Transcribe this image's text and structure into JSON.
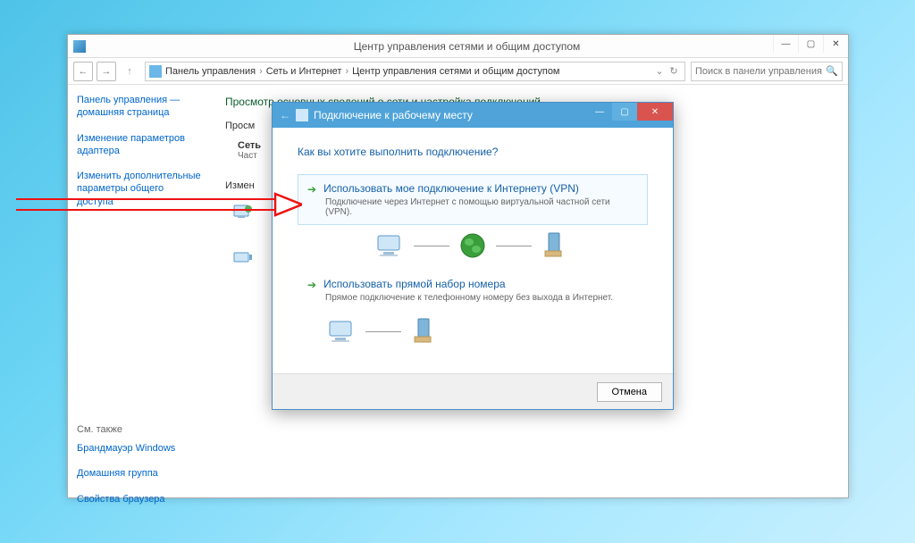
{
  "main_window": {
    "title": "Центр управления сетями и общим доступом",
    "breadcrumb": {
      "items": [
        "Панель управления",
        "Сеть и Интернет",
        "Центр управления сетями и общим доступом"
      ]
    },
    "search": {
      "placeholder": "Поиск в панели управления"
    }
  },
  "sidebar": {
    "links": [
      "Панель управления — домашняя страница",
      "Изменение параметров адаптера",
      "Изменить дополнительные параметры общего доступа"
    ],
    "footer_label": "См. также",
    "footer_links": [
      "Брандмауэр Windows",
      "Домашняя группа",
      "Свойства браузера"
    ]
  },
  "content": {
    "heading": "Просмотр основных сведений о сети и настройка подключений",
    "labels": {
      "view": "Просм",
      "network": "Сеть",
      "network_sub": "Част",
      "change": "Измен"
    }
  },
  "wizard": {
    "title": "Подключение к рабочему месту",
    "question": "Как вы хотите выполнить подключение?",
    "options": [
      {
        "title": "Использовать мое подключение к Интернету (VPN)",
        "desc": "Подключение через Интернет с помощью виртуальной частной сети (VPN)."
      },
      {
        "title": "Использовать прямой набор номера",
        "desc": "Прямое подключение к телефонному номеру без выхода в Интернет."
      }
    ],
    "cancel": "Отмена"
  }
}
